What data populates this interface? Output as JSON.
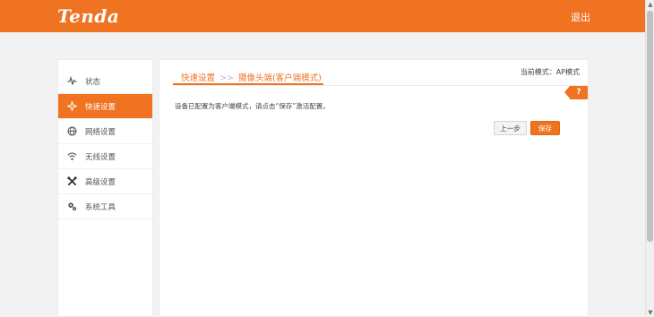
{
  "header": {
    "logo": "Tenda",
    "logout_label": "退出"
  },
  "sidebar": {
    "items": [
      {
        "label": "状态",
        "icon": "pulse-icon",
        "active": false
      },
      {
        "label": "快速设置",
        "icon": "sparkle-icon",
        "active": true
      },
      {
        "label": "网络设置",
        "icon": "globe-icon",
        "active": false
      },
      {
        "label": "无线设置",
        "icon": "wifi-icon",
        "active": false
      },
      {
        "label": "高级设置",
        "icon": "tools-icon",
        "active": false
      },
      {
        "label": "系统工具",
        "icon": "gears-icon",
        "active": false
      }
    ]
  },
  "content": {
    "mode_label": "当前模式：AP模式",
    "breadcrumb": {
      "root": "快速设置",
      "separator": ">>",
      "current": "摄像头端(客户端模式)"
    },
    "help_label": "?",
    "message": "设备已配置为客户端模式，请点击“保存”激活配置。",
    "prev_button": "上一步",
    "save_button": "保存"
  },
  "colors": {
    "accent": "#ef7320",
    "background": "#f2f2f2"
  }
}
